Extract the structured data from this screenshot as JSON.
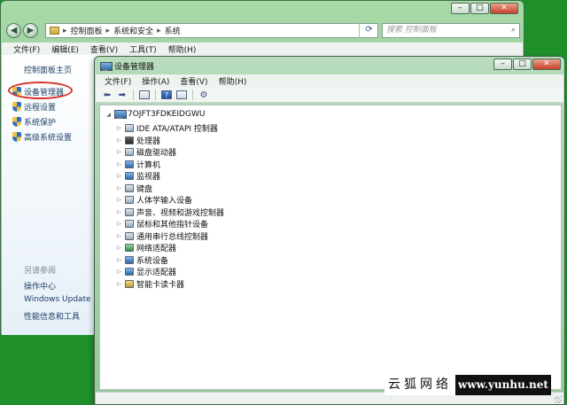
{
  "colors": {
    "desktop": "#1f8f2a",
    "annotation_circle": "#d8342b",
    "link_text": "#1e3f66"
  },
  "control_panel": {
    "caption_buttons": [
      "–",
      "□",
      "✕"
    ],
    "address_path": [
      "控制面板",
      "系统和安全",
      "系统"
    ],
    "search_placeholder": "搜索 控制面板",
    "menu": [
      "文件(F)",
      "编辑(E)",
      "查看(V)",
      "工具(T)",
      "帮助(H)"
    ],
    "sidebar": {
      "home": "控制面板主页",
      "items": [
        "设备管理器",
        "远程设置",
        "系统保护",
        "高级系统设置"
      ],
      "see_also_title": "另请参阅",
      "see_also": [
        "操作中心",
        "Windows Update",
        "性能信息和工具"
      ]
    }
  },
  "device_manager": {
    "title": "设备管理器",
    "caption_buttons": [
      "–",
      "□",
      "✕"
    ],
    "menu": [
      "文件(F)",
      "操作(A)",
      "查看(V)",
      "帮助(H)"
    ],
    "toolbar_icons": [
      "back-icon",
      "forward-icon",
      "properties-icon",
      "help-icon",
      "view-icon",
      "scan-hardware-icon"
    ],
    "root": "7OJFT3FDKEIDGWU",
    "categories": [
      "IDE ATA/ATAPI 控制器",
      "处理器",
      "磁盘驱动器",
      "计算机",
      "监视器",
      "键盘",
      "人体学输入设备",
      "声音、视频和游戏控制器",
      "鼠标和其他指针设备",
      "通用串行总线控制器",
      "网络适配器",
      "系统设备",
      "显示适配器",
      "智能卡读卡器"
    ]
  },
  "watermark": {
    "cn": "云狐网络",
    "url": "www.yunhu.net"
  }
}
